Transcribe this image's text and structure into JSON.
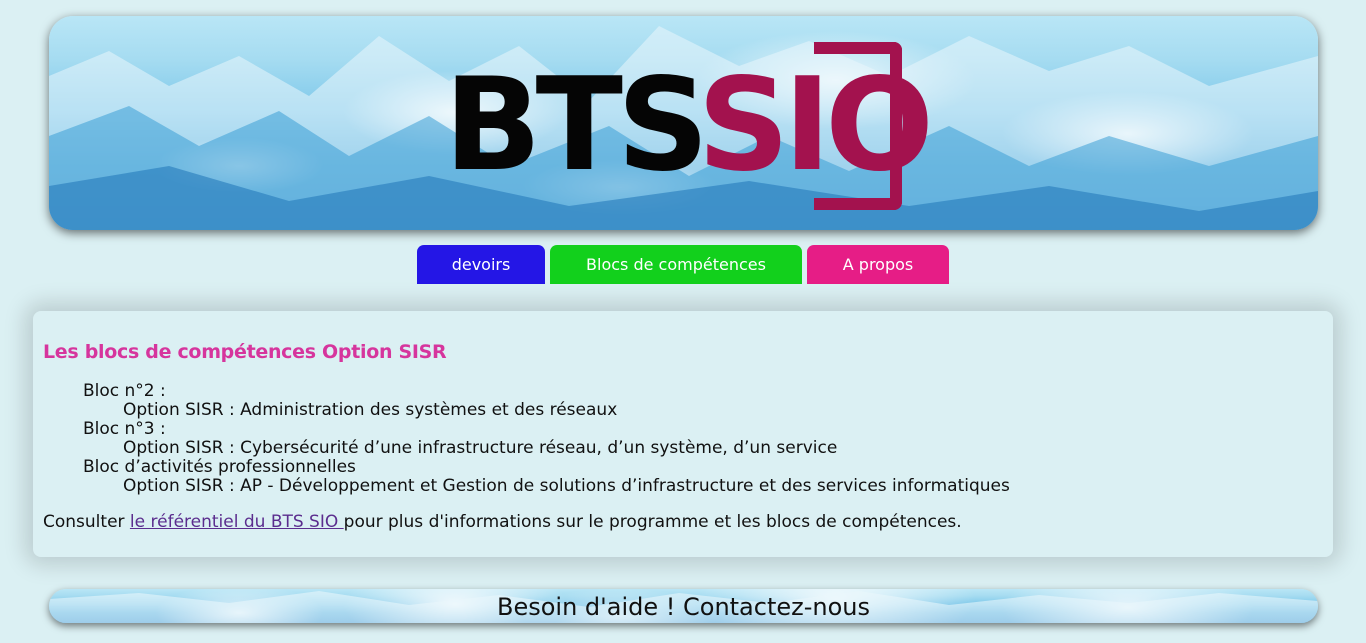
{
  "header": {
    "logo_text_main": "BTS",
    "logo_text_accent": "SIO",
    "logo_accent_color": "#a3124e"
  },
  "nav": {
    "items": [
      {
        "label": "devoirs",
        "color": "#2416e6"
      },
      {
        "label": "Blocs de compétences",
        "color": "#12d01c"
      },
      {
        "label": "A propos",
        "color": "#e61d86"
      }
    ]
  },
  "main": {
    "title": "Les blocs de compétences Option SISR",
    "blocs": [
      {
        "title": "Bloc n°2 :",
        "description": "Option SISR : Administration des systèmes et des réseaux"
      },
      {
        "title": "Bloc n°3 :",
        "description": "Option SISR : Cybersécurité d’une infrastructure réseau, d’un système, d’un service"
      },
      {
        "title": "Bloc d’activités professionnelles",
        "description": "Option SISR : AP - Développement et Gestion de solutions d’infrastructure et des services informatiques"
      }
    ],
    "consult_prefix": "Consulter ",
    "consult_link": "le référentiel du BTS SIO ",
    "consult_suffix": "pour plus d'informations sur le programme et les blocs de compétences."
  },
  "footer": {
    "text": "Besoin d'aide ! Contactez-nous"
  }
}
